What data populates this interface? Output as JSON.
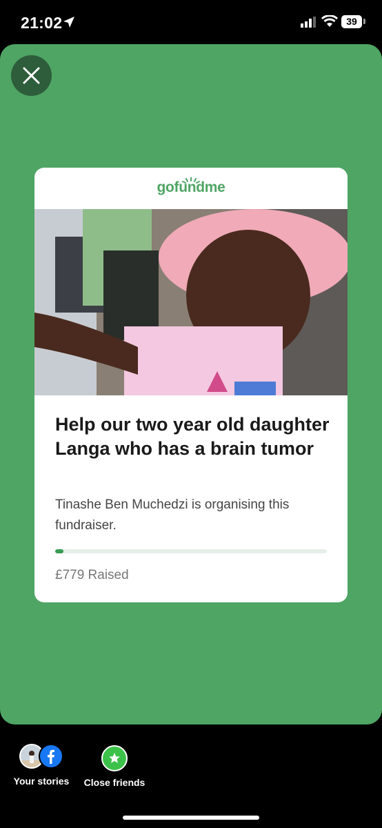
{
  "status_bar": {
    "time": "21:02",
    "battery": "39"
  },
  "card": {
    "brand": "gofundme",
    "title": "Help our two year old daughter Langa who has a brain tumor",
    "organiser": "Tinashe Ben Muchedzi is organising this fundraiser.",
    "raised": "£779 Raised",
    "progress_fraction": 0.03
  },
  "bottom_bar": {
    "your_stories": "Your stories",
    "close_friends": "Close friends"
  },
  "colors": {
    "story_bg": "#4fa564",
    "brand_green": "#4fa564",
    "close_bg": "#2d5d3b"
  },
  "icons": [
    "location-arrow-icon",
    "cellular-signal-icon",
    "wifi-icon",
    "battery-icon",
    "close-icon",
    "facebook-icon",
    "star-icon"
  ]
}
